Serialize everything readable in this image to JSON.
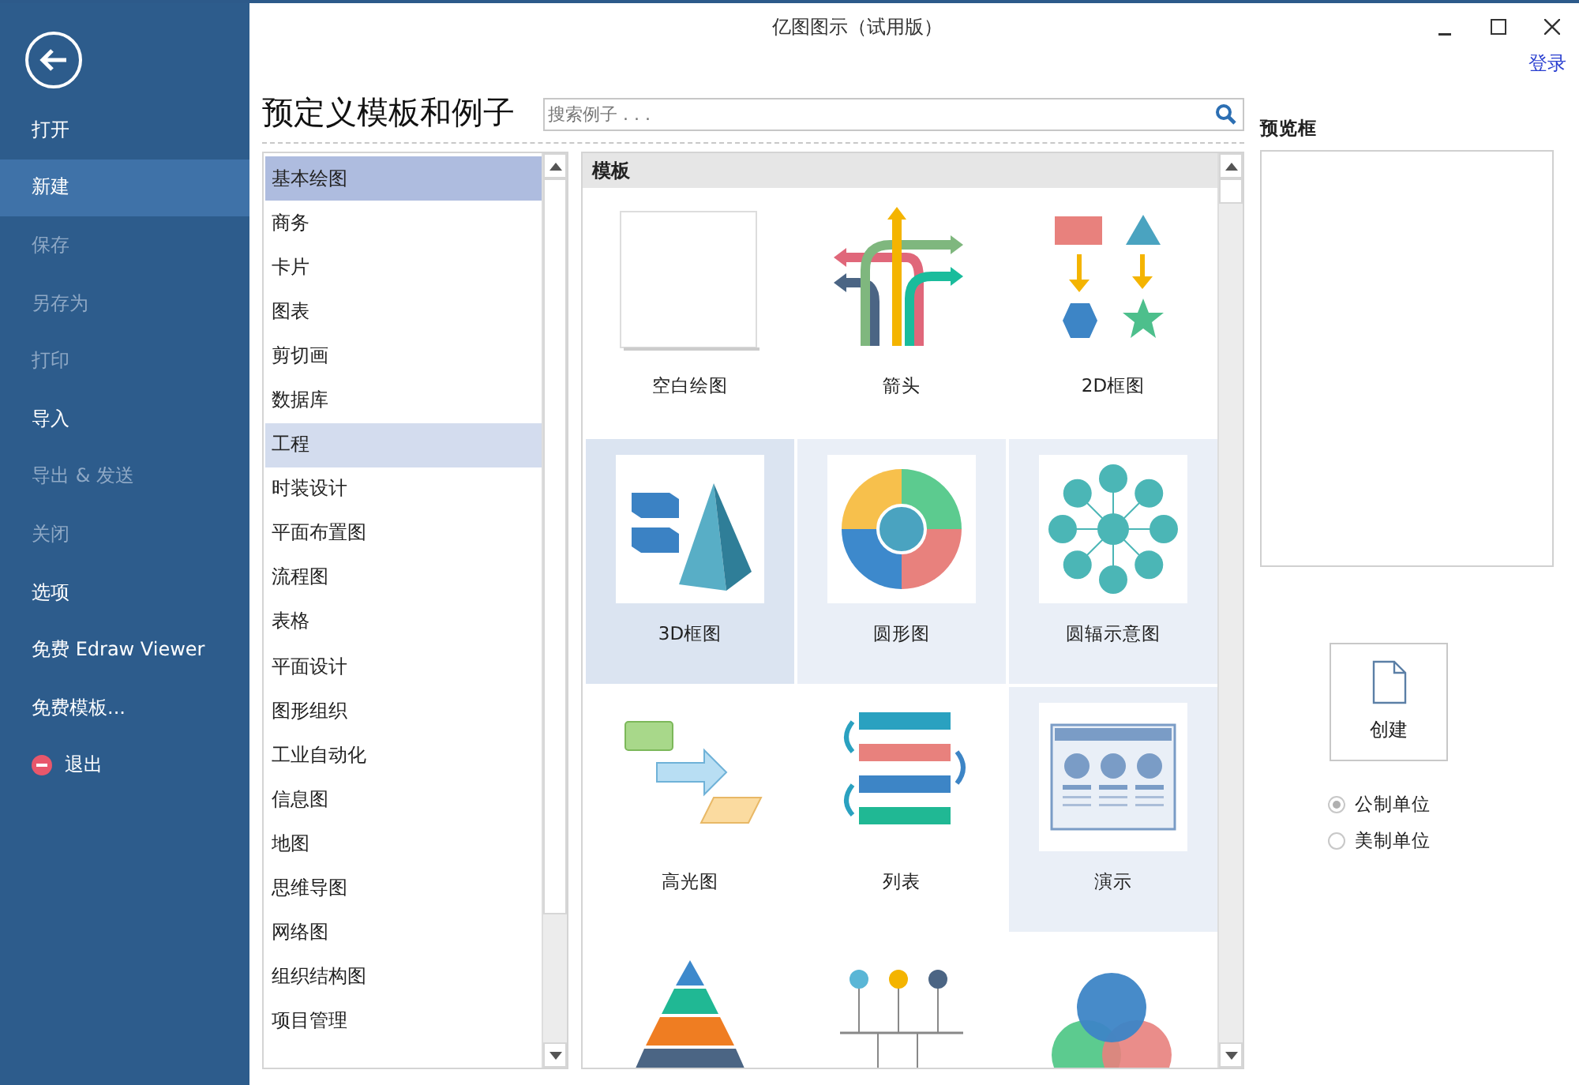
{
  "window": {
    "title": "亿图图示（试用版）",
    "login": "登录"
  },
  "sidebar": {
    "items": [
      {
        "label": "打开",
        "kind": "item",
        "selected": false,
        "disabled": false
      },
      {
        "label": "新建",
        "kind": "item",
        "selected": true,
        "disabled": false
      },
      {
        "label": "保存",
        "kind": "item",
        "selected": false,
        "disabled": true
      },
      {
        "label": "另存为",
        "kind": "item",
        "selected": false,
        "disabled": true
      },
      {
        "label": "打印",
        "kind": "item",
        "selected": false,
        "disabled": true
      },
      {
        "label": "导入",
        "kind": "item",
        "selected": false,
        "disabled": false
      },
      {
        "label": "导出 & 发送",
        "kind": "item",
        "selected": false,
        "disabled": true
      },
      {
        "label": "关闭",
        "kind": "item",
        "selected": false,
        "disabled": true
      },
      {
        "label": "选项",
        "kind": "item",
        "selected": false,
        "disabled": false
      },
      {
        "label": "免费 Edraw Viewer",
        "kind": "item",
        "selected": false,
        "disabled": false
      },
      {
        "label": "免费模板...",
        "kind": "item",
        "selected": false,
        "disabled": false
      },
      {
        "label": "退出",
        "kind": "exit",
        "selected": false,
        "disabled": false
      }
    ]
  },
  "heading": "预定义模板和例子",
  "search": {
    "placeholder": "搜索例子 . . ."
  },
  "categories": [
    {
      "label": "基本绘图",
      "selected": true,
      "highlighted": false
    },
    {
      "label": "商务",
      "selected": false,
      "highlighted": false
    },
    {
      "label": "卡片",
      "selected": false,
      "highlighted": false
    },
    {
      "label": "图表",
      "selected": false,
      "highlighted": false
    },
    {
      "label": "剪切画",
      "selected": false,
      "highlighted": false
    },
    {
      "label": "数据库",
      "selected": false,
      "highlighted": false
    },
    {
      "label": "工程",
      "selected": false,
      "highlighted": true
    },
    {
      "label": "时装设计",
      "selected": false,
      "highlighted": false
    },
    {
      "label": "平面布置图",
      "selected": false,
      "highlighted": false
    },
    {
      "label": "流程图",
      "selected": false,
      "highlighted": false
    },
    {
      "label": "表格",
      "selected": false,
      "highlighted": false
    },
    {
      "label": "平面设计",
      "selected": false,
      "highlighted": false
    },
    {
      "label": "图形组织",
      "selected": false,
      "highlighted": false
    },
    {
      "label": "工业自动化",
      "selected": false,
      "highlighted": false
    },
    {
      "label": "信息图",
      "selected": false,
      "highlighted": false
    },
    {
      "label": "地图",
      "selected": false,
      "highlighted": false
    },
    {
      "label": "思维导图",
      "selected": false,
      "highlighted": false
    },
    {
      "label": "网络图",
      "selected": false,
      "highlighted": false
    },
    {
      "label": "组织结构图",
      "selected": false,
      "highlighted": false
    },
    {
      "label": "项目管理",
      "selected": false,
      "highlighted": false
    }
  ],
  "templates": {
    "header": "模板",
    "items": [
      {
        "label": "空白绘图",
        "kind": "blank",
        "selected": false,
        "highlighted": false
      },
      {
        "label": "箭头",
        "kind": "arrows",
        "selected": false,
        "highlighted": false
      },
      {
        "label": "2D框图",
        "kind": "shapes2d",
        "selected": false,
        "highlighted": false
      },
      {
        "label": "3D框图",
        "kind": "shapes3d",
        "selected": true,
        "highlighted": false
      },
      {
        "label": "圆形图",
        "kind": "circle",
        "selected": false,
        "highlighted": true
      },
      {
        "label": "圆辐示意图",
        "kind": "radial",
        "selected": false,
        "highlighted": true
      },
      {
        "label": "高光图",
        "kind": "highlight",
        "selected": false,
        "highlighted": false
      },
      {
        "label": "列表",
        "kind": "list",
        "selected": false,
        "highlighted": false
      },
      {
        "label": "演示",
        "kind": "slide",
        "selected": false,
        "highlighted": true
      },
      {
        "kind": "pyramid",
        "selected": false,
        "highlighted": false
      },
      {
        "kind": "timeline",
        "selected": false,
        "highlighted": false
      },
      {
        "kind": "venn",
        "selected": false,
        "highlighted": false
      }
    ]
  },
  "preview": {
    "title": "预览框"
  },
  "create_button": "创建",
  "units": [
    {
      "label": "公制单位",
      "selected": true
    },
    {
      "label": "美制单位",
      "selected": false
    }
  ]
}
